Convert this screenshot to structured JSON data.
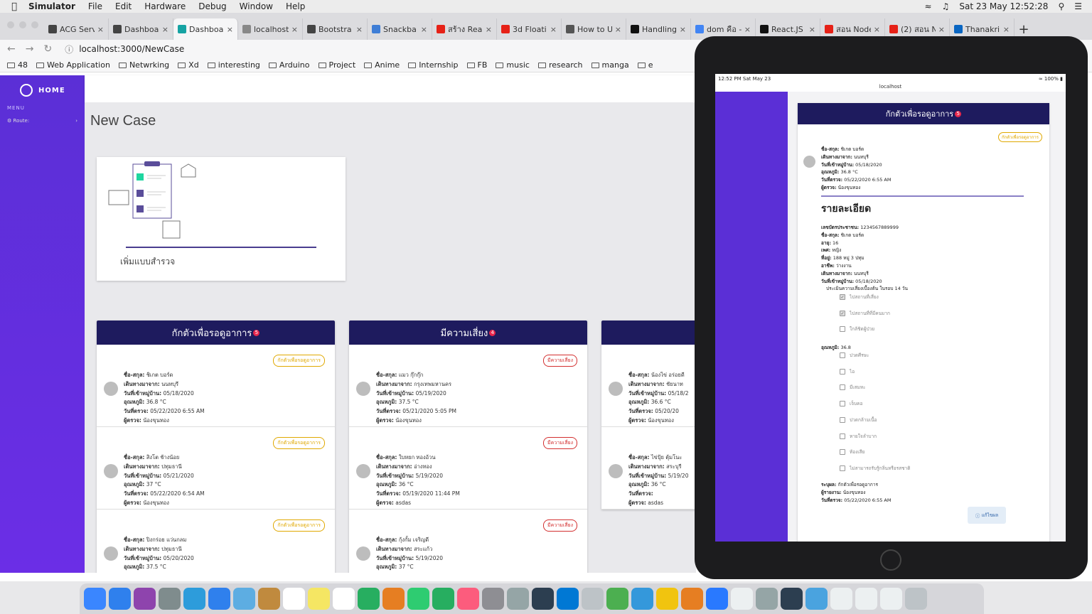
{
  "menubar": {
    "apple": "",
    "items": [
      "Simulator",
      "File",
      "Edit",
      "Hardware",
      "Debug",
      "Window",
      "Help"
    ],
    "clock": "Sat 23 May  12:52:28"
  },
  "tabs": [
    {
      "label": "ACG Serv",
      "icon": "search-icon",
      "color": "#444"
    },
    {
      "label": "Dashboa",
      "icon": "globe-icon",
      "color": "#444"
    },
    {
      "label": "Dashboa",
      "icon": "app-icon",
      "color": "#16a3a3",
      "active": true
    },
    {
      "label": "localhost",
      "icon": "chart-icon",
      "color": "#888"
    },
    {
      "label": "Bootstra",
      "icon": "globe-icon",
      "color": "#444"
    },
    {
      "label": "Snackba",
      "icon": "material-icon",
      "color": "#3f7ed6"
    },
    {
      "label": "สร้าง Rea",
      "icon": "youtube-icon",
      "color": "#e62117"
    },
    {
      "label": "3d Floati",
      "icon": "youtube-icon",
      "color": "#e62117"
    },
    {
      "label": "How to U",
      "icon": "link-icon",
      "color": "#555"
    },
    {
      "label": "Handling",
      "icon": "medium-icon",
      "color": "#111"
    },
    {
      "label": "dom คือ -",
      "icon": "google-icon",
      "color": "#4285f4"
    },
    {
      "label": "React.JS",
      "icon": "medium-icon",
      "color": "#111"
    },
    {
      "label": "สอน Node",
      "icon": "youtube-icon",
      "color": "#e62117"
    },
    {
      "label": "(2) สอน N",
      "icon": "youtube-icon",
      "color": "#e62117"
    },
    {
      "label": "Thanakri",
      "icon": "linkedin-icon",
      "color": "#0a66c2"
    }
  ],
  "address": {
    "url": "localhost:3000/NewCase"
  },
  "bookmarks": [
    "48",
    "Web Application",
    "Netwrking",
    "Xd",
    "interesting",
    "Arduino",
    "Project",
    "Anime",
    "Internship",
    "FB",
    "music",
    "research",
    "manga",
    "e"
  ],
  "sidebar": {
    "home": "HOME",
    "menu": "MENU",
    "route": "Route:"
  },
  "page": {
    "title": "New Case",
    "survey_label": "เพิ่มแบบสำรวจ"
  },
  "columns": [
    {
      "title": "กักตัวเพื่อรอดูอาการ",
      "count": "5",
      "cards": [
        {
          "status": "กักตัวเพื่อรอดูอาการ",
          "risk": false,
          "name": "ชิเกต บอร์ด",
          "from": "นนทบุรี",
          "arrival": "05/18/2020",
          "temp": "36.8 °C",
          "checked": "05/22/2020 6:55 AM",
          "checker": "น้องขุนทอง"
        },
        {
          "status": "กักตัวเพื่อรอดูอาการ",
          "risk": false,
          "name": "สิงโต ช้างน้อย",
          "from": "ปทุมธานี",
          "arrival": "05/21/2020",
          "temp": "37 °C",
          "checked": "05/22/2020 6:54 AM",
          "checker": "น้องขุนทอง"
        },
        {
          "status": "กักตัวเพื่อรอดูอาการ",
          "risk": false,
          "name": "ปิงกร่อย แว่นกลม",
          "from": "ปทุมธานี",
          "arrival": "05/20/2020",
          "temp": "37.5 °C",
          "checked": "",
          "checker": ""
        }
      ]
    },
    {
      "title": "มีความเสี่ยง",
      "count": "4",
      "cards": [
        {
          "status": "มีความเสี่ยง",
          "risk": true,
          "name": "แมว กุ๊กกุ๊ก",
          "from": "กรุงเทพมหานคร",
          "arrival": "05/19/2020",
          "temp": "37.5 °C",
          "checked": "05/21/2020 5:05 PM",
          "checker": "น้องขุนทอง"
        },
        {
          "status": "มีความเสี่ยง",
          "risk": true,
          "name": "ใบหยก ทองอ้วน",
          "from": "อ่างทอง",
          "arrival": "5/19/2020",
          "temp": "36 °C",
          "checked": "05/19/2020 11:44 PM",
          "checker": "asdas"
        },
        {
          "status": "มีความเสี่ยง",
          "risk": true,
          "name": "กุ้งกั้ม เจริญดี",
          "from": "สระแก้ว",
          "arrival": "5/19/2020",
          "temp": "37 °C",
          "checked": "",
          "checker": ""
        }
      ]
    },
    {
      "title": "",
      "count": "",
      "cards": [
        {
          "status": "",
          "risk": false,
          "name": "น้องไข่ อร่อยดี",
          "from": "ชัยนาท",
          "arrival": "05/18/2",
          "temp": "36.6 °C",
          "checked": "05/20/20",
          "checker": "น้องขุนทอง"
        },
        {
          "status": "",
          "risk": false,
          "name": "ไข่ปุ้ย ตุ้มโนะ",
          "from": "สระบุรี",
          "arrival": "5/19/20",
          "temp": "36 °C",
          "checked": "",
          "checker": "asdas"
        }
      ]
    }
  ],
  "labels": {
    "name": "ชื่อ-สกุล:",
    "from": "เดินทางมาจาก:",
    "arrival": "วันที่เข้าหมู่บ้าน:",
    "temp": "อุณหภูมิ:",
    "checked": "วันที่ตรวจ:",
    "checker": "ผู้ตรวจ:"
  },
  "ipad": {
    "time": "12:52 PM  Sat May 23",
    "battery": "100%",
    "host": "localhost",
    "card": {
      "title": "กักตัวเพื่อรอดูอาการ",
      "count": "5",
      "status": "กักตัวเพื่อรอดูอาการ",
      "name": "ชิเกต บอร์ด",
      "from": "นนทบุรี",
      "arrival": "05/18/2020",
      "temp": "36.8 °C",
      "checked": "05/22/2020 6:55 AM",
      "checker": "น้องขุนทอง",
      "details_title": "รายละเอียด",
      "details": [
        {
          "k": "เลขบัตรประชาชน:",
          "v": "1234567889999"
        },
        {
          "k": "ชื่อ-สกุล:",
          "v": "ชิเกต บอร์ด"
        },
        {
          "k": "อายุ:",
          "v": "16"
        },
        {
          "k": "เพศ:",
          "v": "หญิง"
        },
        {
          "k": "ที่อยู่:",
          "v": "188 หมู่ 3 ปทุม"
        },
        {
          "k": "อาชีพ:",
          "v": "ว่างงาน"
        },
        {
          "k": "เดินทางมาจาก:",
          "v": "นนทบุรี"
        },
        {
          "k": "วันที่เข้าหมู่บ้าน:",
          "v": "05/18/2020"
        }
      ],
      "assess": "ประเมินความเสี่ยงเบื้องต้น ในรอบ 14 วัน",
      "risk_checks": [
        {
          "label": "ไปสถานที่เสี่ยง",
          "on": true
        },
        {
          "label": "ไปสถานที่ที่มีคนมาก",
          "on": true
        },
        {
          "label": "ใกล้ชิดผู้ป่วย",
          "on": false
        }
      ],
      "temp_label": "อุณหภูมิ:",
      "temp_value": "36.8",
      "symptoms": [
        "ปวดศีรษะ",
        "ไอ",
        "มีเสมหะ",
        "เจ็บคอ",
        "ปวดกล้ามเนื้อ",
        "หายใจลำบาก",
        "ท้องเสีย",
        "ไม่สามารถรับรู้กลิ่นหรือรสชาติ"
      ],
      "footer": [
        {
          "k": "ระบุผล:",
          "v": "กักตัวเพื่อรอดูอาการ"
        },
        {
          "k": "ผู้รายงาน:",
          "v": "น้องขุนทอง"
        },
        {
          "k": "วันที่ตรวจ:",
          "v": "05/22/2020 6:55 AM"
        }
      ],
      "edit_label": "แก้ไขผล"
    }
  }
}
